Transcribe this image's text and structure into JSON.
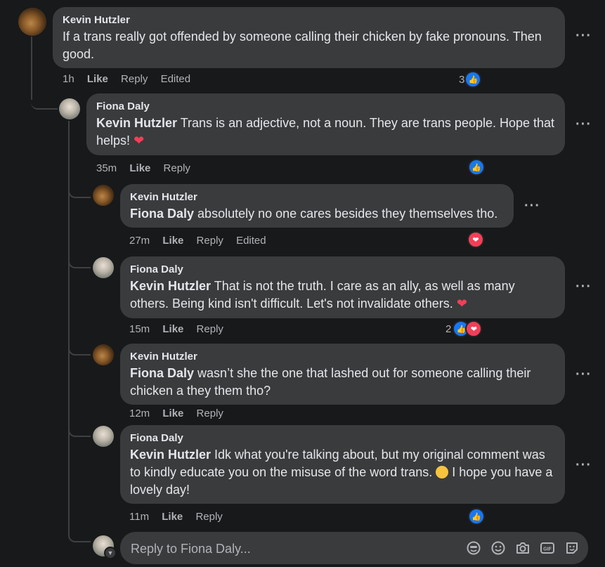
{
  "comments": [
    {
      "author": "Kevin Hutzler",
      "mention": "",
      "text": "If a trans really got offended by someone calling their chicken by fake pronouns. Then good.",
      "time": "1h",
      "like": "Like",
      "reply": "Reply",
      "edited": "Edited",
      "reaction_count": "3"
    },
    {
      "author": "Fiona Daly",
      "mention": "Kevin Hutzler",
      "text": "Trans is an adjective, not a noun. They are trans people. Hope that helps!",
      "time": "35m",
      "like": "Like",
      "reply": "Reply"
    },
    {
      "author": "Kevin Hutzler",
      "mention": "Fiona Daly",
      "text": "absolutely no one cares besides they themselves tho.",
      "time": "27m",
      "like": "Like",
      "reply": "Reply",
      "edited": "Edited"
    },
    {
      "author": "Fiona Daly",
      "mention": "Kevin Hutzler",
      "text": "That is not the truth. I care as an ally, as well as many others. Being kind isn't difficult. Let's not invalidate others.",
      "time": "15m",
      "like": "Like",
      "reply": "Reply",
      "reaction_count": "2"
    },
    {
      "author": "Kevin Hutzler",
      "mention": "Fiona Daly",
      "text": "wasn’t she the one that lashed out for someone calling their chicken a they them tho?",
      "time": "12m",
      "like": "Like",
      "reply": "Reply"
    },
    {
      "author": "Fiona Daly",
      "mention": "Kevin Hutzler",
      "text_before": "Idk what you're talking about, but my original comment was to kindly educate you on the misuse of the word trans.",
      "text_after": "I hope you have a lovely day!",
      "time": "11m",
      "like": "Like",
      "reply": "Reply"
    }
  ],
  "reply_box": {
    "placeholder": "Reply to Fiona Daly...",
    "icons": [
      "avatar-sticker-icon",
      "emoji-icon",
      "camera-icon",
      "gif-icon",
      "sticker-icon"
    ]
  },
  "colors": {
    "background": "#18191a",
    "bubble": "#3a3b3c",
    "like_blue": "#1877f2",
    "love_red": "#f33e58"
  }
}
